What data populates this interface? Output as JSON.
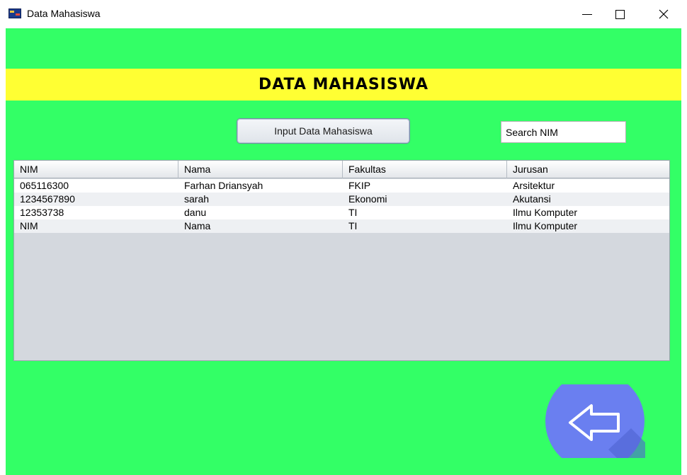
{
  "window": {
    "title": "Data Mahasiswa",
    "minimize_icon": "minimize-icon",
    "maximize_icon": "maximize-icon",
    "close_icon": "close-icon"
  },
  "header": {
    "title": "DATA MAHASISWA"
  },
  "toolbar": {
    "input_button_label": "Input Data Mahasiswa",
    "search_value": "Search NIM"
  },
  "table": {
    "columns": [
      "NIM",
      "Nama",
      "Fakultas",
      "Jurusan"
    ],
    "rows": [
      [
        "065116300",
        "Farhan Driansyah",
        "FKIP",
        "Arsitektur"
      ],
      [
        "1234567890",
        "sarah",
        "Ekonomi",
        "Akutansi"
      ],
      [
        "12353738",
        "danu",
        "TI",
        "Ilmu Komputer"
      ],
      [
        "NIM",
        "Nama",
        "TI",
        "Ilmu Komputer"
      ]
    ]
  },
  "back_button": {
    "icon": "arrow-left-icon"
  },
  "colors": {
    "background": "#33ff66",
    "banner": "#ffff33",
    "back_circle": "#6a7ff0"
  }
}
